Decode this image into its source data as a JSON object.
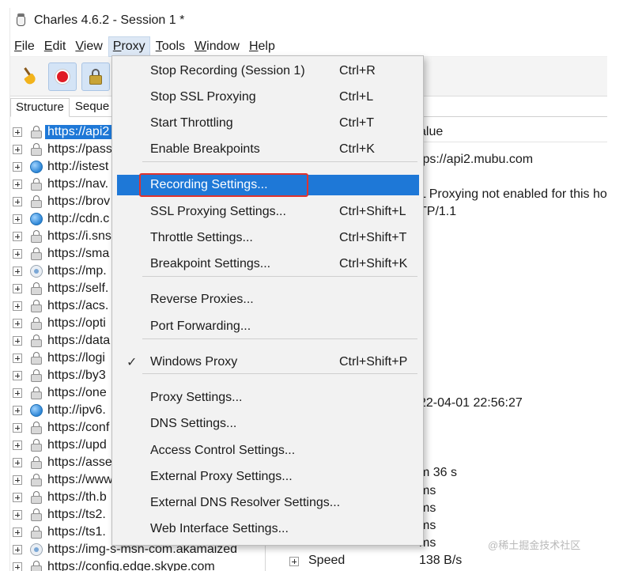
{
  "window": {
    "title": "Charles 4.6.2 - Session 1 *"
  },
  "menubar": [
    {
      "name": "menu-file",
      "label": "File",
      "underline": "F",
      "rest": "ile",
      "active": false
    },
    {
      "name": "menu-edit",
      "label": "Edit",
      "underline": "E",
      "rest": "dit",
      "active": false
    },
    {
      "name": "menu-view",
      "label": "View",
      "underline": "V",
      "rest": "iew",
      "active": false
    },
    {
      "name": "menu-proxy",
      "label": "Proxy",
      "underline": "P",
      "rest": "roxy",
      "active": true
    },
    {
      "name": "menu-tools",
      "label": "Tools",
      "underline": "T",
      "rest": "ools",
      "active": false
    },
    {
      "name": "menu-window",
      "label": "Window",
      "underline": "W",
      "rest": "indow",
      "active": false
    },
    {
      "name": "menu-help",
      "label": "Help",
      "underline": "H",
      "rest": "elp",
      "active": false
    }
  ],
  "toolbar": {
    "broom": "broom-icon",
    "record": "record-icon",
    "ssl": "lock-icon"
  },
  "left_pane": {
    "tabs": [
      "Structure",
      "Seque"
    ],
    "hosts": [
      {
        "text": "https://api2",
        "icon": "lock",
        "selected": true
      },
      {
        "text": "https://pass",
        "icon": "lock"
      },
      {
        "text": "http://istest",
        "icon": "globe"
      },
      {
        "text": "https://nav.",
        "icon": "lock"
      },
      {
        "text": "https://brov",
        "icon": "lock"
      },
      {
        "text": "http://cdn.c",
        "icon": "globe"
      },
      {
        "text": "https://i.sns",
        "icon": "lock"
      },
      {
        "text": "https://sma",
        "icon": "lock"
      },
      {
        "text": "https://mp.",
        "icon": "img"
      },
      {
        "text": "https://self.",
        "icon": "lock"
      },
      {
        "text": "https://acs.",
        "icon": "lock"
      },
      {
        "text": "https://opti",
        "icon": "lock"
      },
      {
        "text": "https://data",
        "icon": "lock"
      },
      {
        "text": "https://logi",
        "icon": "lock"
      },
      {
        "text": "https://by3",
        "icon": "lock"
      },
      {
        "text": "https://one",
        "icon": "lock"
      },
      {
        "text": "http://ipv6.",
        "icon": "globe"
      },
      {
        "text": "https://conf",
        "icon": "lock"
      },
      {
        "text": "https://upd",
        "icon": "lock"
      },
      {
        "text": "https://asse",
        "icon": "lock"
      },
      {
        "text": "https://www",
        "icon": "lock"
      },
      {
        "text": "https://th.b",
        "icon": "lock"
      },
      {
        "text": "https://ts2.",
        "icon": "lock"
      },
      {
        "text": "https://ts1.",
        "icon": "lock"
      },
      {
        "text": "https://img-s-msn-com.akamaized",
        "icon": "img"
      },
      {
        "text": "https://config.edge.skype.com",
        "icon": "lock"
      }
    ]
  },
  "right_pane": {
    "header": "t",
    "value_col": "alue",
    "url": "tps://api2.mubu.com",
    "ssl_note": "L Proxying not enabled for this ho",
    "protocol": "TP/1.1",
    "timestamp": "22-04-01 22:56:27",
    "duration": "m 36 s",
    "ms1": "ms",
    "ms2": "ms",
    "ms3": "ms",
    "ms4": "ms",
    "speed_label": "Speed",
    "speed_value": "138 B/s"
  },
  "proxy_menu": {
    "items": [
      {
        "name": "stop-recording-item",
        "label": "Stop Recording (Session 1)",
        "shortcut": "Ctrl+R",
        "check": ""
      },
      {
        "name": "stop-ssl-proxying-item",
        "label": "Stop SSL Proxying",
        "shortcut": "Ctrl+L",
        "check": ""
      },
      {
        "name": "start-throttling-item",
        "label": "Start Throttling",
        "shortcut": "Ctrl+T",
        "check": ""
      },
      {
        "name": "enable-breakpoints-item",
        "label": "Enable Breakpoints",
        "shortcut": "Ctrl+K",
        "check": ""
      },
      {
        "name": "recording-settings-item",
        "label": "Recording Settings...",
        "shortcut": "",
        "check": "",
        "highlighted": true
      },
      {
        "name": "ssl-proxying-settings-item",
        "label": "SSL Proxying Settings...",
        "shortcut": "Ctrl+Shift+L",
        "check": ""
      },
      {
        "name": "throttle-settings-item",
        "label": "Throttle Settings...",
        "shortcut": "Ctrl+Shift+T",
        "check": ""
      },
      {
        "name": "breakpoint-settings-item",
        "label": "Breakpoint Settings...",
        "shortcut": "Ctrl+Shift+K",
        "check": ""
      },
      {
        "name": "reverse-proxies-item",
        "label": "Reverse Proxies...",
        "shortcut": "",
        "check": ""
      },
      {
        "name": "port-forwarding-item",
        "label": "Port Forwarding...",
        "shortcut": "",
        "check": ""
      },
      {
        "name": "windows-proxy-item",
        "label": "Windows Proxy",
        "shortcut": "Ctrl+Shift+P",
        "check": "✓"
      },
      {
        "name": "proxy-settings-item",
        "label": "Proxy Settings...",
        "shortcut": "",
        "check": ""
      },
      {
        "name": "dns-settings-item",
        "label": "DNS Settings...",
        "shortcut": "",
        "check": ""
      },
      {
        "name": "access-control-settings-item",
        "label": "Access Control Settings...",
        "shortcut": "",
        "check": ""
      },
      {
        "name": "external-proxy-settings-item",
        "label": "External Proxy Settings...",
        "shortcut": "",
        "check": ""
      },
      {
        "name": "external-dns-resolver-settings-item",
        "label": "External DNS Resolver Settings...",
        "shortcut": "",
        "check": ""
      },
      {
        "name": "web-interface-settings-item",
        "label": "Web Interface Settings...",
        "shortcut": "",
        "check": ""
      }
    ]
  },
  "watermark": "@稀土掘金技术社区",
  "colors": {
    "selection": "#1e78d7",
    "highlight_box": "#e0332e",
    "record": "#e01b24"
  }
}
